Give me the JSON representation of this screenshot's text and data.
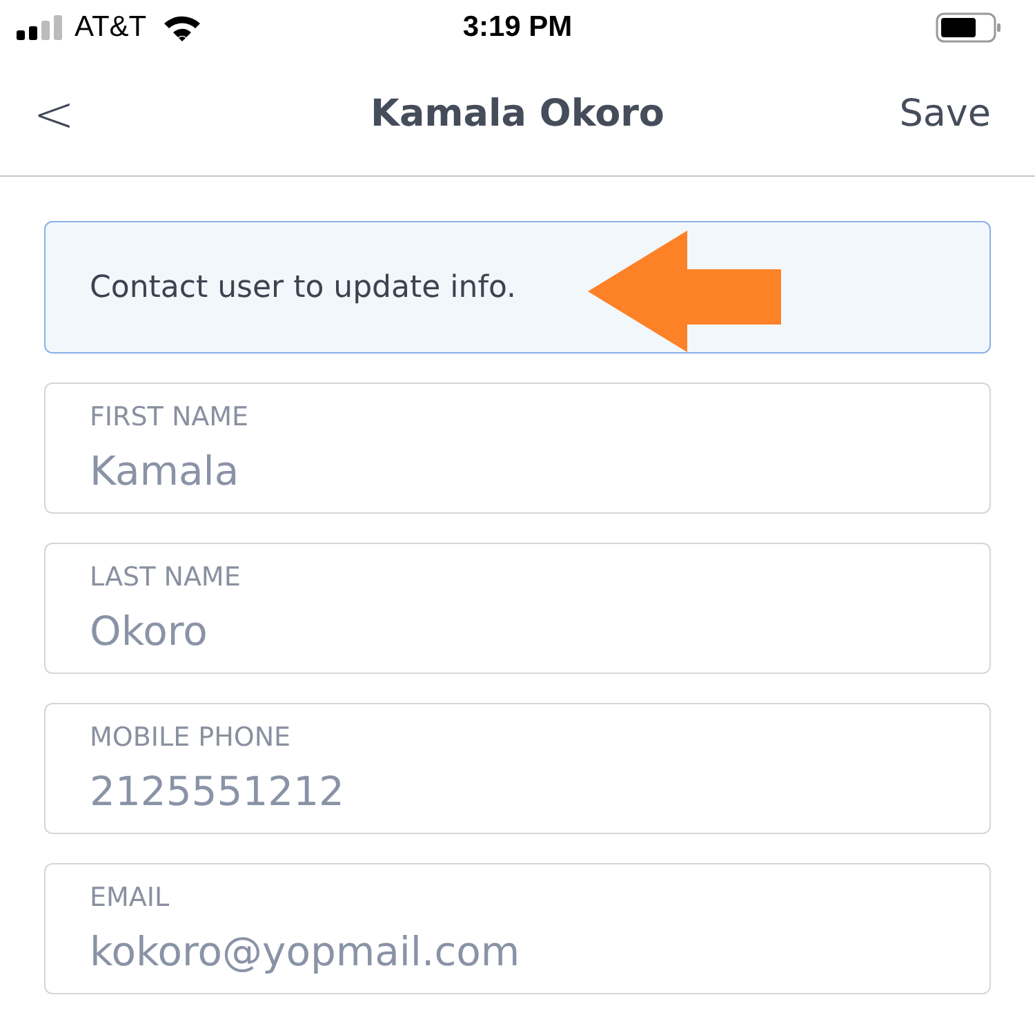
{
  "status_bar": {
    "carrier": "AT&T",
    "time": "3:19 PM"
  },
  "nav_bar": {
    "back": "<",
    "title": "Kamala Okoro",
    "action": "Save"
  },
  "notice": {
    "text": "Contact user to update info."
  },
  "fields": [
    {
      "label": "FIRST NAME",
      "value": "Kamala",
      "disabled": true
    },
    {
      "label": "LAST NAME",
      "value": "Okoro",
      "disabled": true
    },
    {
      "label": "MOBILE PHONE",
      "value": "2125551212",
      "disabled": true
    },
    {
      "label": "EMAIL",
      "value": "kokoro@yopmail.com",
      "disabled": true
    }
  ]
}
